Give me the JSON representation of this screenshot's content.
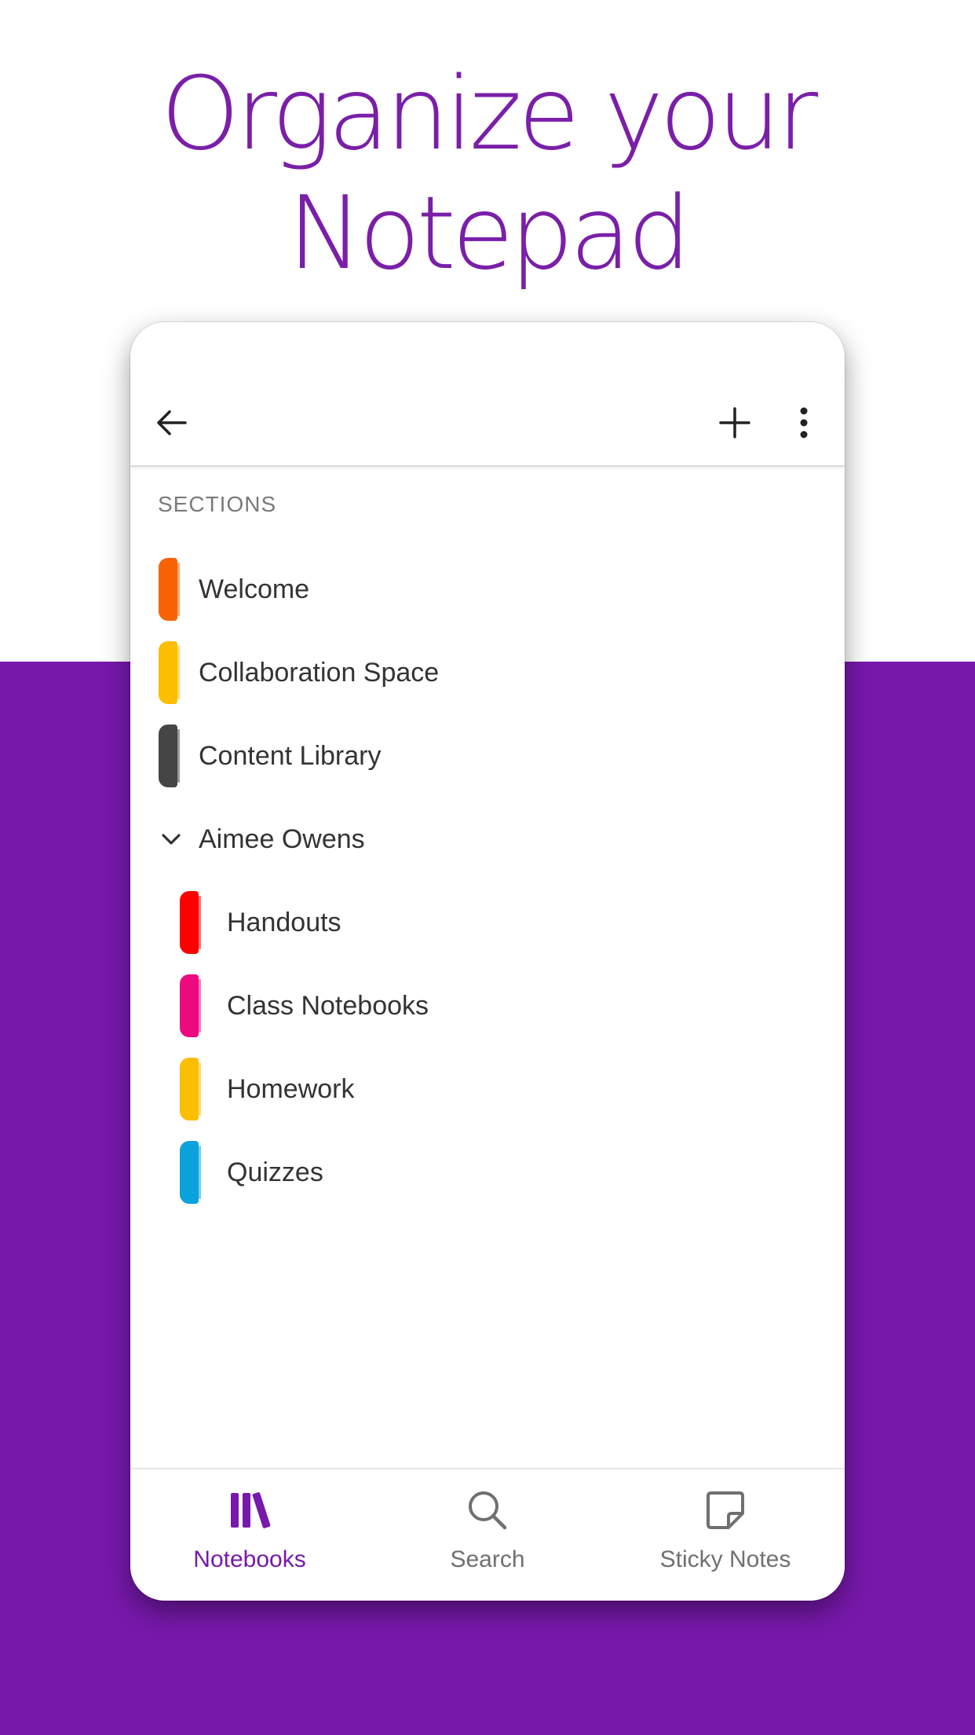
{
  "headline": {
    "line1": "Organize your",
    "line2": "Notepad"
  },
  "colors": {
    "brand": "#7719AA",
    "background_purple": "#7718ab"
  },
  "toolbar": {
    "back_icon": "arrow-left-icon",
    "add_icon": "plus-icon",
    "more_icon": "more-vertical-icon"
  },
  "sections": {
    "header": "SECTIONS",
    "items": [
      {
        "label": "Welcome",
        "color": "#F76304"
      },
      {
        "label": "Collaboration Space",
        "color": "#FCBE00"
      },
      {
        "label": "Content Library",
        "color": "#454545"
      }
    ],
    "group": {
      "label": "Aimee Owens",
      "expanded": true,
      "icon": "chevron-down-icon",
      "items": [
        {
          "label": "Handouts",
          "color": "#FF0000"
        },
        {
          "label": "Class Notebooks",
          "color": "#EC0A7E"
        },
        {
          "label": "Homework",
          "color": "#FCBE00"
        },
        {
          "label": "Quizzes",
          "color": "#0AA2DC"
        }
      ]
    }
  },
  "bottom_nav": {
    "items": [
      {
        "label": "Notebooks",
        "icon": "notebooks-icon",
        "active": true
      },
      {
        "label": "Search",
        "icon": "search-icon",
        "active": false
      },
      {
        "label": "Sticky Notes",
        "icon": "sticky-note-icon",
        "active": false
      }
    ],
    "active_color": "#7719AA",
    "inactive_color": "#707070"
  }
}
